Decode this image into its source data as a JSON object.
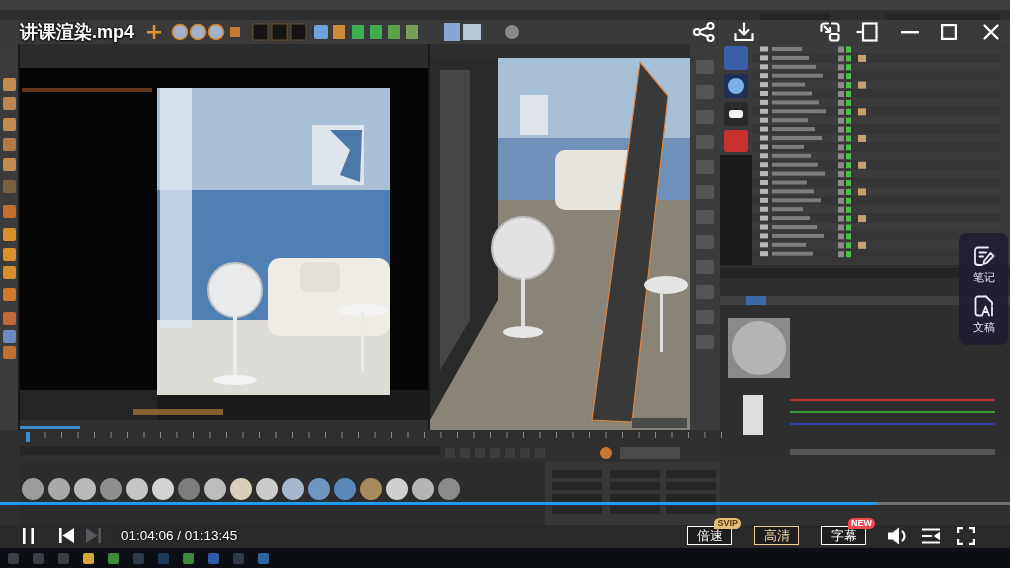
{
  "video": {
    "title": "讲课渲染.mp4"
  },
  "side_panel": {
    "items": [
      {
        "kind": "notes",
        "label": "笔记"
      },
      {
        "kind": "transcript",
        "label": "文稿"
      }
    ]
  },
  "progress": {
    "level": 0.869
  },
  "controls": {
    "playing": true,
    "next_disabled": true,
    "time": "01:04:06 / 01:13:45",
    "options": [
      {
        "label": "倍速",
        "accent": false,
        "badge": {
          "text": "SVIP",
          "color": "#e2be79"
        }
      },
      {
        "label": "高清",
        "accent": true
      },
      {
        "label": "字幕",
        "accent": false,
        "badge": {
          "text": "NEW",
          "color": "#f2474e"
        }
      }
    ]
  }
}
